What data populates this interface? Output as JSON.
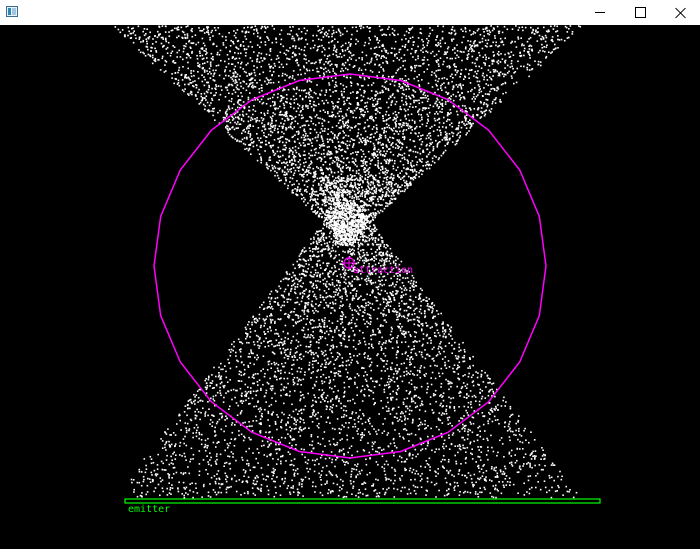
{
  "window": {
    "title": "",
    "icon": "application-window-icon",
    "controls": [
      "minimize",
      "maximize",
      "close"
    ]
  },
  "scene": {
    "background": "#000000",
    "particle_color": "#ffffff",
    "attractor": {
      "label": "attraction",
      "color": "#ff00ff"
    },
    "emitter": {
      "label": "emitter",
      "color": "#00ff00"
    }
  }
}
